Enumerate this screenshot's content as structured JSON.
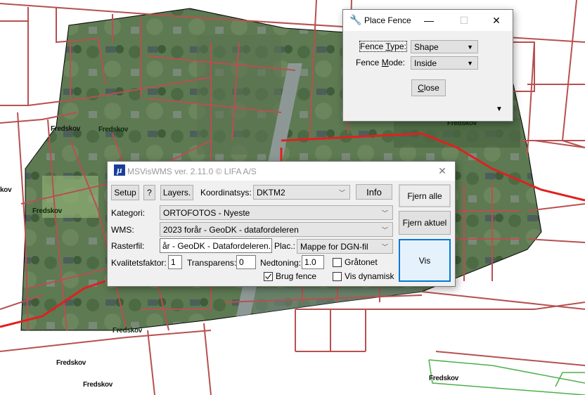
{
  "map": {
    "background_color": "#ffffff",
    "parcel_color": "#b85050",
    "road_color": "#e02020",
    "labels": [
      {
        "text": "Fredskov",
        "style": "light"
      },
      {
        "text": "Fredskov",
        "style": "dark"
      },
      {
        "text": "Fredskov",
        "style": "light"
      },
      {
        "text": "Fredskov",
        "style": "dark"
      },
      {
        "text": "Fredskov",
        "style": "dark"
      },
      {
        "text": "Fredskov",
        "style": "dark"
      },
      {
        "text": "Fredskov",
        "style": "light"
      },
      {
        "text": "Fredskov",
        "style": "light"
      },
      {
        "text": "Fredskov",
        "style": "light"
      },
      {
        "text": "Fredskov",
        "style": "light"
      },
      {
        "text": "kov",
        "style": "light"
      }
    ]
  },
  "place_fence": {
    "title": "Place Fence",
    "window_controls": {
      "minimize": "—",
      "maximize": "☐",
      "close": "✕"
    },
    "fence_type": {
      "label_pre": "Fence ",
      "label_ul": "T",
      "label_post": "ype:",
      "value": "Shape"
    },
    "fence_mode": {
      "label_pre": "Fence ",
      "label_ul": "M",
      "label_post": "ode:",
      "value": "Inside"
    },
    "close_button": {
      "label_ul": "C",
      "label_post": "lose"
    },
    "expand_arrow": "▼"
  },
  "mswms": {
    "title": "MSVisWMS ver. 2.11.0  © LIFA A/S",
    "logo_glyph": "μ",
    "close_glyph": "✕",
    "toolbar": {
      "setup": "Setup",
      "help": "?",
      "layers": "Layers.",
      "koordinatsys_label": "Koordinatsys:",
      "koordinatsys_value": "DKTM2",
      "info": "Info"
    },
    "kategori": {
      "label": "Kategori:",
      "value": "ORTOFOTOS - Nyeste"
    },
    "wms": {
      "label": "WMS:",
      "value": "2023 forår - GeoDK - datafordeleren"
    },
    "rasterfil": {
      "label": "Rasterfil:",
      "value": "år - GeoDK - Datafordeleren.png"
    },
    "plac": {
      "label": "Plac.:",
      "value": "Mappe for DGN-fil"
    },
    "kvalitetsfaktor": {
      "label": "Kvalitetsfaktor:",
      "value": "1"
    },
    "transparens": {
      "label": "Transparens:",
      "value": "0"
    },
    "nedtoning": {
      "label": "Nedtoning:",
      "value": "1.0"
    },
    "gratonet": {
      "label": "Gråtonet",
      "checked": false
    },
    "brug_fence": {
      "label": "Brug fence",
      "checked": true
    },
    "vis_dynamisk": {
      "label": "Vis dynamisk",
      "checked": false
    },
    "buttons": {
      "fjern_alle": "Fjern alle",
      "fjern_aktuel": "Fjern aktuel",
      "vis": "Vis"
    },
    "accent_color": "#0078d7"
  }
}
